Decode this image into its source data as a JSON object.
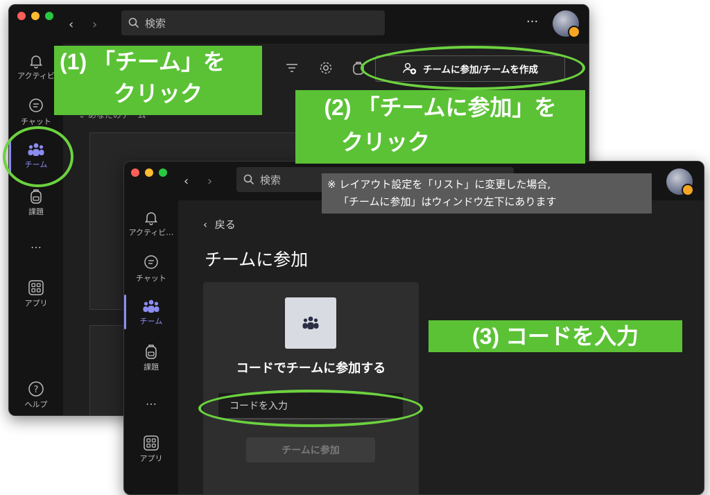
{
  "back_window": {
    "search_placeholder": "検索",
    "rail": [
      {
        "label": "アクティビ"
      },
      {
        "label": "チャット"
      },
      {
        "label": "チーム"
      },
      {
        "label": "課題"
      },
      {
        "label": "…"
      },
      {
        "label": "アプリ"
      },
      {
        "label": "ヘルプ"
      }
    ],
    "section_title": "あなたのチーム",
    "join_create_button": "チームに参加/チームを作成"
  },
  "front_window": {
    "search_placeholder": "検索",
    "rail": [
      {
        "label": "アクティビ…"
      },
      {
        "label": "チャット"
      },
      {
        "label": "チーム"
      },
      {
        "label": "課題"
      },
      {
        "label": "…"
      },
      {
        "label": "アプリ"
      }
    ],
    "back_link": "戻る",
    "page_title": "チームに参加",
    "card_title": "コードでチームに参加する",
    "code_input_placeholder": "コードを入力",
    "join_button": "チームに参加"
  },
  "callouts": {
    "step1_line1": "(1) 「チーム」を",
    "step1_line2": "クリック",
    "step2_line1": "(2) 「チームに参加」を",
    "step2_line2": "クリック",
    "step3": "(3) コードを入力"
  },
  "note": {
    "line1": "※ レイアウト設定を「リスト」に変更した場合,",
    "line2": "「チームに参加」はウィンドウ左下にあります"
  },
  "colors": {
    "callout_green": "#5bc236",
    "ring_green": "#6cd23f",
    "accent_purple": "#8b8cf0"
  }
}
